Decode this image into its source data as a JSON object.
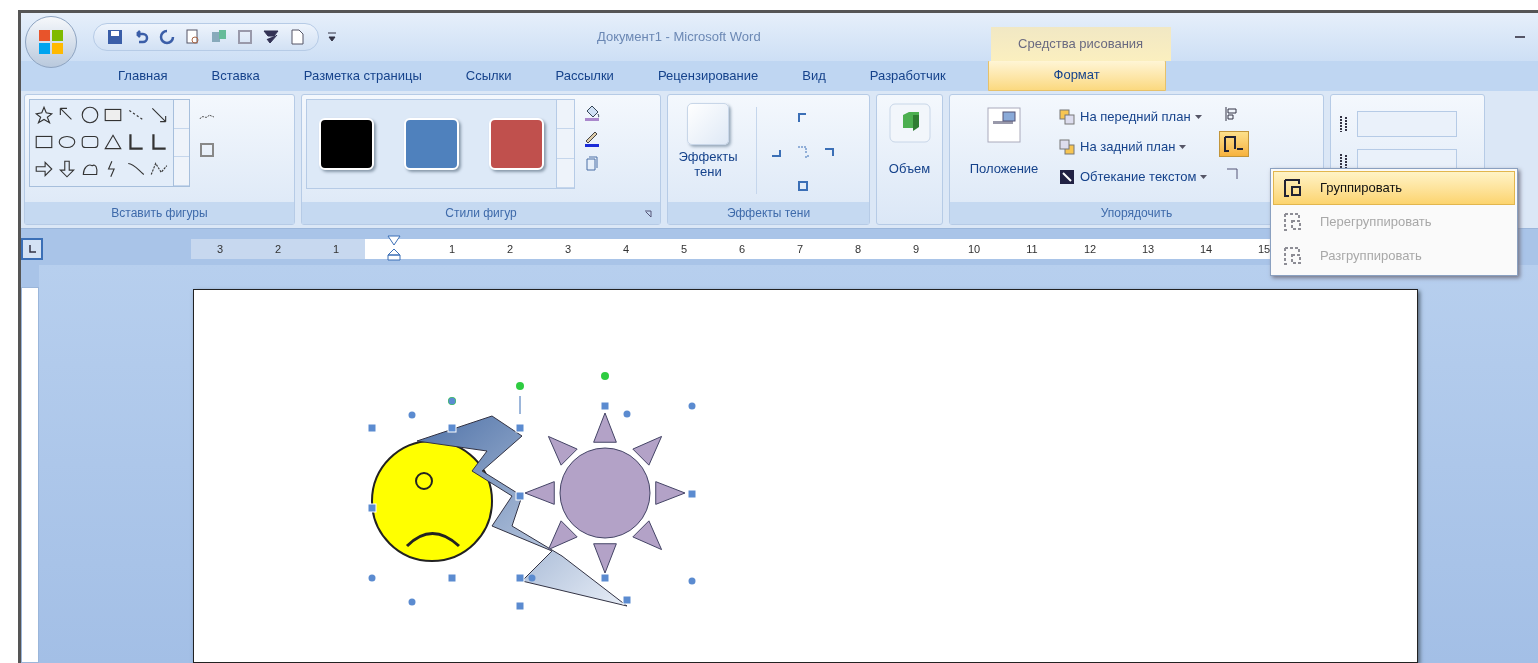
{
  "window": {
    "title": "Документ1 - Microsoft Word",
    "context_group": "Средства рисования"
  },
  "tabs": [
    {
      "label": "Главная",
      "selected": false
    },
    {
      "label": "Вставка",
      "selected": false
    },
    {
      "label": "Разметка страницы",
      "selected": false
    },
    {
      "label": "Ссылки",
      "selected": false
    },
    {
      "label": "Рассылки",
      "selected": false
    },
    {
      "label": "Рецензирование",
      "selected": false
    },
    {
      "label": "Вид",
      "selected": false
    },
    {
      "label": "Разработчик",
      "selected": false
    },
    {
      "label": "Формат",
      "selected": true
    }
  ],
  "groups": [
    {
      "kind": "shapes",
      "label": "Вставить фигуры"
    },
    {
      "kind": "styles",
      "label": "Стили фигур",
      "swatches": [
        {
          "color": "#000000"
        },
        {
          "color": "#4f81bd"
        },
        {
          "color": "#c0504d"
        }
      ]
    },
    {
      "kind": "shadow",
      "label": "Эффекты тени",
      "button": "Эффекты тени"
    },
    {
      "kind": "volume",
      "button": "Объем"
    },
    {
      "kind": "arrange",
      "label": "Упорядочить",
      "button": "Положение",
      "commands": [
        "На передний план",
        "На задний план",
        "Обтекание текстом"
      ]
    },
    {
      "kind": "size"
    }
  ],
  "menu": {
    "items": [
      {
        "label": "Группировать",
        "selected": true,
        "disabled": false
      },
      {
        "label": "Перегруппировать",
        "selected": false,
        "disabled": true
      },
      {
        "label": "Разгруппировать",
        "selected": false,
        "disabled": true
      }
    ]
  },
  "ruler": {
    "numbers": [
      "3",
      "2",
      "1",
      "1",
      "2",
      "3",
      "4",
      "5",
      "6",
      "7",
      "8",
      "9",
      "10",
      "11",
      "12",
      "13",
      "14",
      "15"
    ]
  }
}
